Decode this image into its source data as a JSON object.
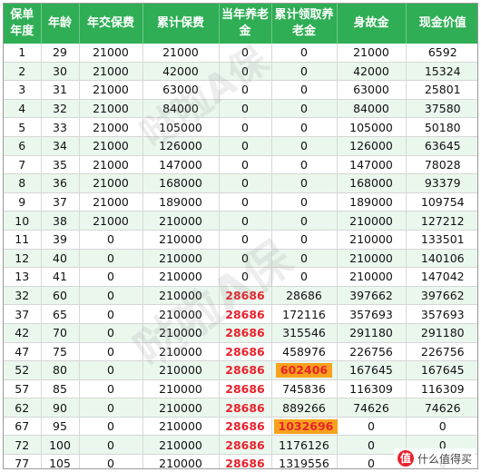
{
  "table": {
    "headers": [
      "保单年度",
      "年龄",
      "年交保费",
      "累计保费",
      "当年养老金",
      "累计领取养老金",
      "身故金",
      "现金价值"
    ],
    "rows": [
      [
        "1",
        "29",
        "21000",
        "21000",
        "0",
        "0",
        "21000",
        "6592"
      ],
      [
        "2",
        "30",
        "21000",
        "42000",
        "0",
        "0",
        "42000",
        "15324"
      ],
      [
        "3",
        "31",
        "21000",
        "63000",
        "0",
        "0",
        "63000",
        "25801"
      ],
      [
        "4",
        "32",
        "21000",
        "84000",
        "0",
        "0",
        "84000",
        "37580"
      ],
      [
        "5",
        "33",
        "21000",
        "105000",
        "0",
        "0",
        "105000",
        "50180"
      ],
      [
        "6",
        "34",
        "21000",
        "126000",
        "0",
        "0",
        "126000",
        "63645"
      ],
      [
        "7",
        "35",
        "21000",
        "147000",
        "0",
        "0",
        "147000",
        "78028"
      ],
      [
        "8",
        "36",
        "21000",
        "168000",
        "0",
        "0",
        "168000",
        "93379"
      ],
      [
        "9",
        "37",
        "21000",
        "189000",
        "0",
        "0",
        "189000",
        "109754"
      ],
      [
        "10",
        "38",
        "21000",
        "210000",
        "0",
        "0",
        "210000",
        "127212"
      ],
      [
        "11",
        "39",
        "0",
        "210000",
        "0",
        "0",
        "210000",
        "133501"
      ],
      [
        "12",
        "40",
        "0",
        "210000",
        "0",
        "0",
        "210000",
        "140106"
      ],
      [
        "13",
        "41",
        "0",
        "210000",
        "0",
        "0",
        "210000",
        "147042"
      ],
      [
        "32",
        "60",
        "0",
        "210000",
        "28686",
        "28686",
        "397662",
        "397662"
      ],
      [
        "37",
        "65",
        "0",
        "210000",
        "28686",
        "172116",
        "357693",
        "357693"
      ],
      [
        "42",
        "70",
        "0",
        "210000",
        "28686",
        "315546",
        "291180",
        "291180"
      ],
      [
        "47",
        "75",
        "0",
        "210000",
        "28686",
        "458976",
        "226756",
        "226756"
      ],
      [
        "52",
        "80",
        "0",
        "210000",
        "28686",
        "602406",
        "167645",
        "167645"
      ],
      [
        "57",
        "85",
        "0",
        "210000",
        "28686",
        "745836",
        "116309",
        "116309"
      ],
      [
        "62",
        "90",
        "0",
        "210000",
        "28686",
        "889266",
        "74626",
        "74626"
      ],
      [
        "67",
        "95",
        "0",
        "210000",
        "28686",
        "1032696",
        "0",
        "0"
      ],
      [
        "72",
        "100",
        "0",
        "210000",
        "28686",
        "1176126",
        "0",
        "0"
      ],
      [
        "77",
        "105",
        "0",
        "210000",
        "28686",
        "1319556",
        "0",
        "0"
      ]
    ],
    "highlight_rows": [
      17,
      20
    ],
    "colors": {
      "header_bg": "#2fae55",
      "row_alt": "#eaf7ed",
      "pension_red": "#e8222d",
      "highlight_bg": "#f7a21c"
    }
  },
  "watermark": {
    "text": "哒啦A保"
  },
  "badge": {
    "icon": "值",
    "text": "什么值得买"
  }
}
